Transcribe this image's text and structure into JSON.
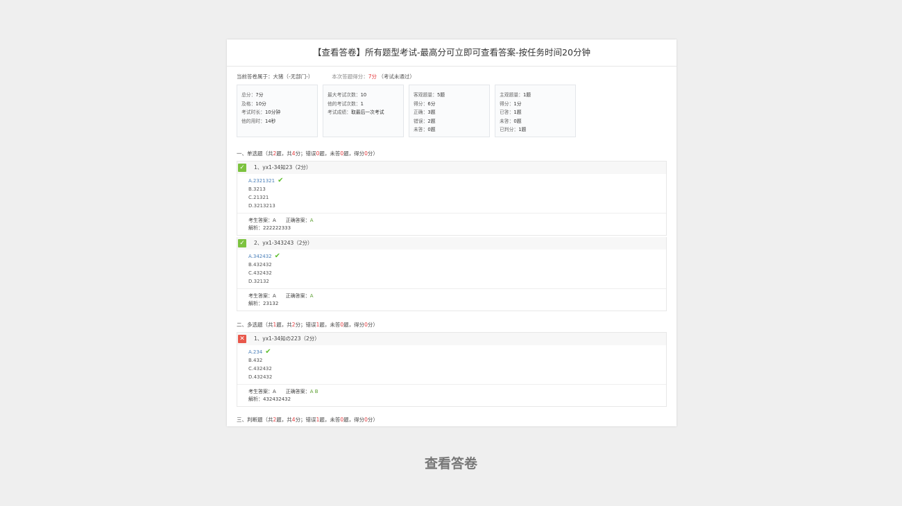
{
  "page": {
    "title": "【查看答卷】所有题型考试-最高分可立即可查看答案-按任务时间20分钟",
    "caption": "查看答卷"
  },
  "summary": {
    "owner_label": "当前答卷属于：",
    "owner_value": "大猪（-无部门-）",
    "score_label": "本次答题得分：",
    "score_value": "7分",
    "result": "（考试未通过）"
  },
  "stats": {
    "box1": [
      {
        "label": "总分：",
        "value": "7分"
      },
      {
        "label": "及格：",
        "value": "10分"
      },
      {
        "label": "考试时长：",
        "value": "10分钟"
      },
      {
        "label": "他的用时：",
        "value": "14秒"
      }
    ],
    "box2": [
      {
        "label": "最大考试次数：",
        "value": "10"
      },
      {
        "label": "他的考试次数：",
        "value": "1"
      },
      {
        "label": "考试成绩：",
        "value": "取最后一次考试"
      }
    ],
    "box3": [
      {
        "label": "客观题量：",
        "value": "5题"
      },
      {
        "label": "得分：",
        "value": "6分"
      },
      {
        "label": "正确：",
        "value": "3题"
      },
      {
        "label": "错误：",
        "value": "2题"
      },
      {
        "label": "未答：",
        "value": "0题"
      }
    ],
    "box4": [
      {
        "label": "主观题量：",
        "value": "1题"
      },
      {
        "label": "得分：",
        "value": "1分"
      },
      {
        "label": "已答：",
        "value": "1题"
      },
      {
        "label": "未答：",
        "value": "0题"
      },
      {
        "label": "已判分：",
        "value": "1题"
      }
    ]
  },
  "sections": [
    {
      "name": "一、单选题",
      "p1": "（共",
      "count": "2",
      "p2": "题，共",
      "points": "4",
      "p3": "分；错误",
      "wrong": "0",
      "p4": "题，未答",
      "unanswered": "0",
      "p5": "题，得分",
      "score": "0",
      "p6": "分）",
      "questions": [
        {
          "badge": "✓",
          "head": "1、yx1-34知23（2分）",
          "options": [
            "A.2321321",
            "B.3213",
            "C.21321",
            "D.3213213"
          ],
          "student_label": "考生答案：",
          "student": "A",
          "correct_label": "正确答案：",
          "correct": "A",
          "analysis_label": "解析：",
          "analysis": "222222333"
        },
        {
          "badge": "✓",
          "head": "2、yx1-343243（2分）",
          "options": [
            "A.342432",
            "B.432432",
            "C.432432",
            "D.32132"
          ],
          "student_label": "考生答案：",
          "student": "A",
          "correct_label": "正确答案：",
          "correct": "A",
          "analysis_label": "解析：",
          "analysis": "23132"
        }
      ]
    },
    {
      "name": "二、多选题",
      "p1": "（共",
      "count": "1",
      "p2": "题，共",
      "points": "2",
      "p3": "分；错误",
      "wrong": "1",
      "p4": "题，未答",
      "unanswered": "0",
      "p5": "题，得分",
      "score": "0",
      "p6": "分）",
      "questions": [
        {
          "badge": "✕",
          "head": "1、yx1-34知の223（2分）",
          "options": [
            "A.234",
            "B.432",
            "C.432432",
            "D.432432"
          ],
          "student_label": "考生答案：",
          "student": "A",
          "correct_label": "正确答案：",
          "correct": "A B",
          "analysis_label": "解析：",
          "analysis": "432432432"
        }
      ]
    },
    {
      "name": "三、判断题",
      "p1": "（共",
      "count": "2",
      "p2": "题，共",
      "points": "4",
      "p3": "分；错误",
      "wrong": "1",
      "p4": "题，未答",
      "unanswered": "0",
      "p5": "题，得分",
      "score": "0",
      "p6": "分）"
    }
  ],
  "icons": {
    "correct_mark": "check-icon",
    "wrong_badge": "x-icon"
  },
  "colors": {
    "accent_red": "#e4393c",
    "ok_green": "#7cc23f",
    "bad_red": "#e8574a",
    "option_blue": "#4a7fb9"
  }
}
